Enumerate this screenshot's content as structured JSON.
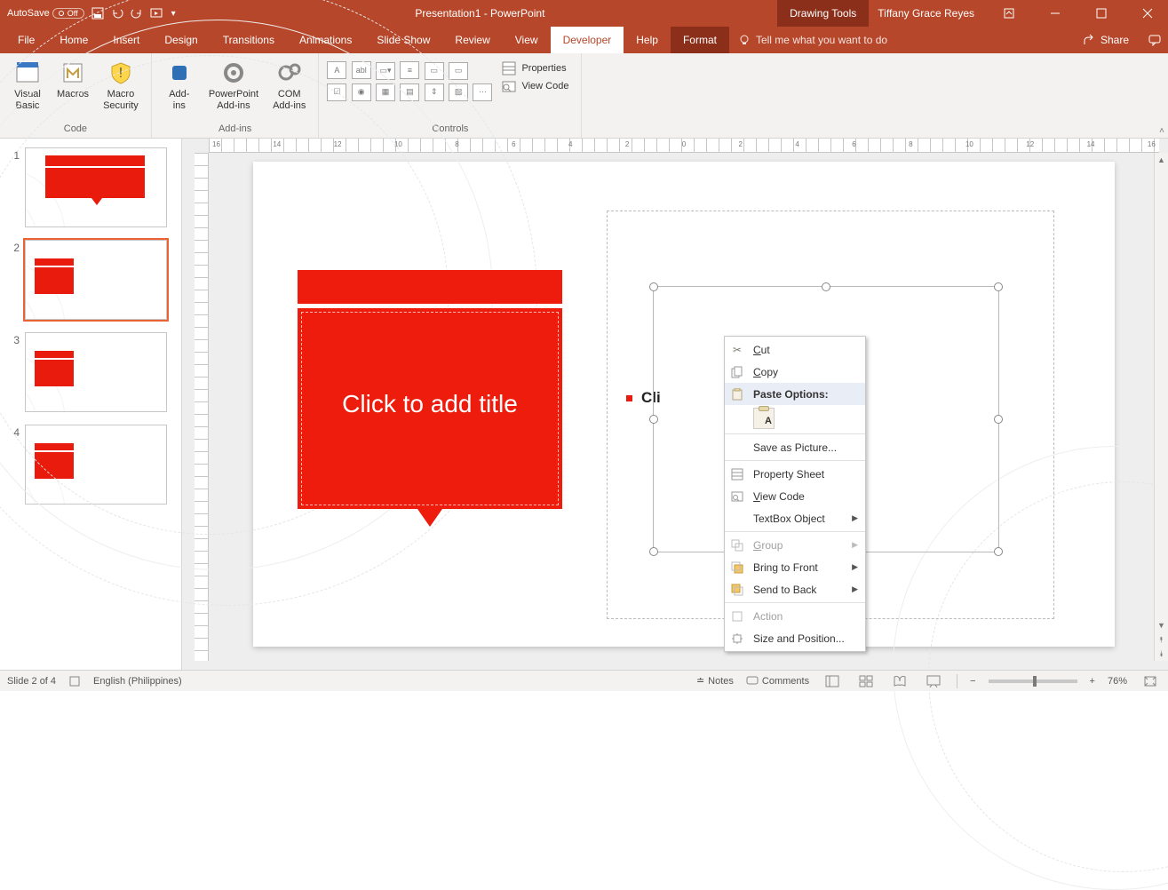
{
  "titlebar": {
    "autosave_label": "AutoSave",
    "autosave_state": "Off",
    "title": "Presentation1 - PowerPoint",
    "tool_context": "Drawing Tools",
    "user": "Tiffany Grace Reyes"
  },
  "tabs": {
    "file": "File",
    "home": "Home",
    "insert": "Insert",
    "design": "Design",
    "transitions": "Transitions",
    "animations": "Animations",
    "slideshow": "Slide Show",
    "review": "Review",
    "view": "View",
    "developer": "Developer",
    "help": "Help",
    "format": "Format",
    "tellme": "Tell me what you want to do",
    "share": "Share"
  },
  "ribbon": {
    "code": {
      "label": "Code",
      "visual_basic": "Visual\nBasic",
      "macros": "Macros",
      "macro_security": "Macro\nSecurity"
    },
    "addins": {
      "label": "Add-ins",
      "addins": "Add-\nins",
      "ppt_addins": "PowerPoint\nAdd-ins",
      "com_addins": "COM\nAdd-ins"
    },
    "controls": {
      "label": "Controls",
      "properties": "Properties",
      "view_code": "View Code"
    }
  },
  "slide": {
    "title_placeholder": "Click to add title",
    "body_placeholder_prefix": "Cli"
  },
  "context_menu": {
    "cut": "Cut",
    "copy": "Copy",
    "paste_options": "Paste Options:",
    "save_as_picture": "Save as Picture...",
    "property_sheet": "Property Sheet",
    "view_code": "View Code",
    "textbox_object": "TextBox Object",
    "group": "Group",
    "bring_to_front": "Bring to Front",
    "send_to_back": "Send to Back",
    "action": "Action",
    "size_and_position": "Size and Position..."
  },
  "statusbar": {
    "slide_pos": "Slide 2 of 4",
    "language": "English (Philippines)",
    "notes": "Notes",
    "comments": "Comments",
    "zoom": "76%"
  },
  "thumbnails": [
    "1",
    "2",
    "3",
    "4"
  ]
}
